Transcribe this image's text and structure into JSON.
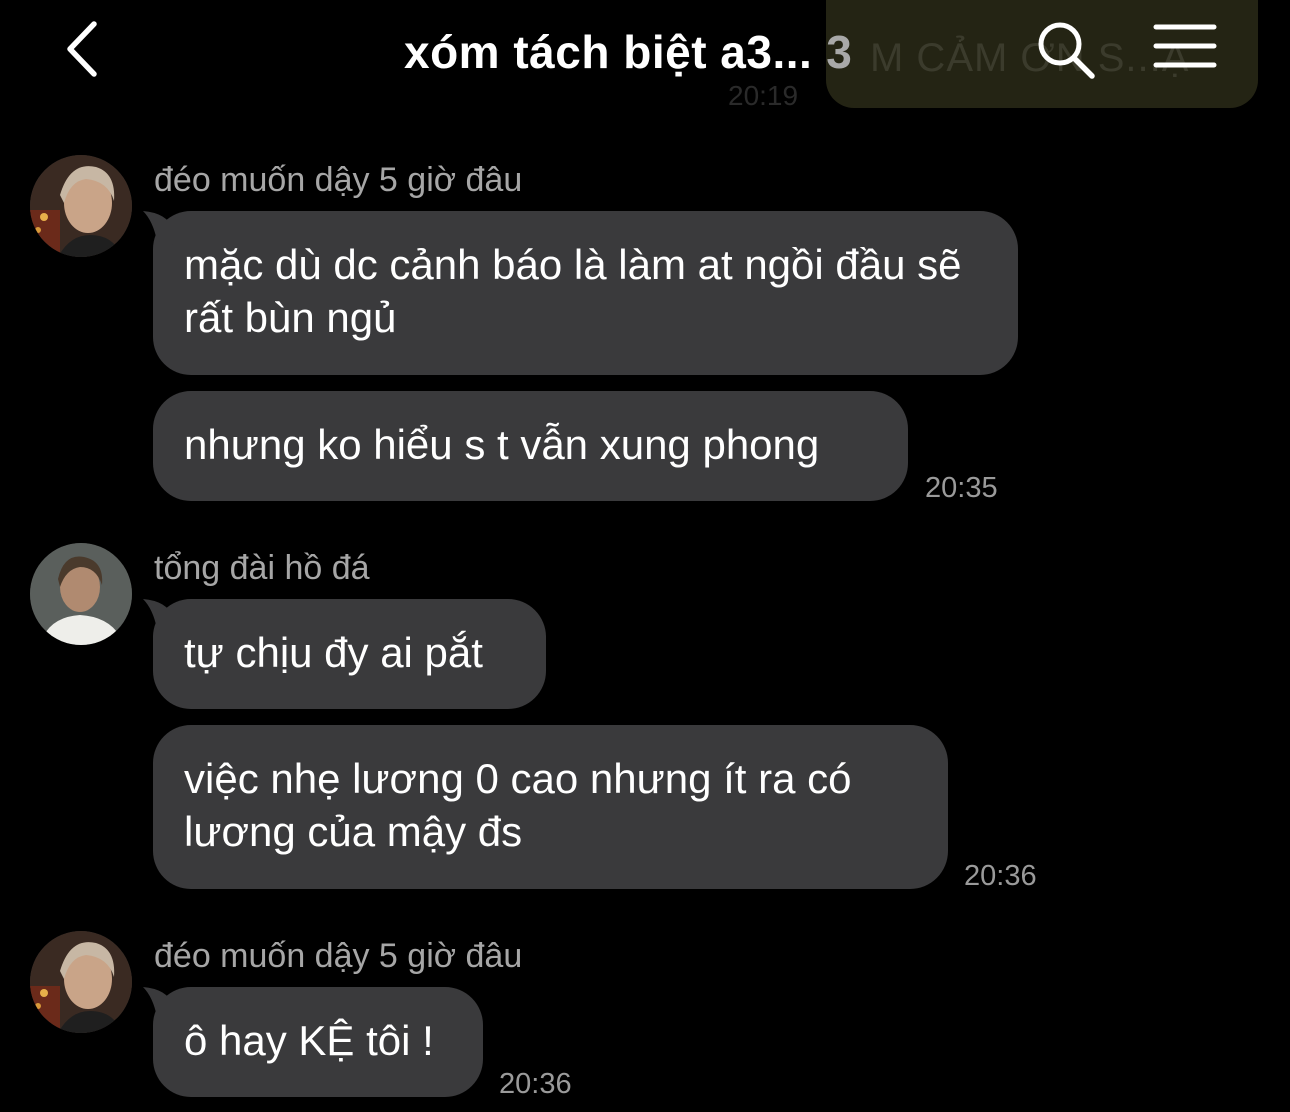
{
  "header": {
    "title": "xóm tách biệt a3...",
    "member_count": "3",
    "background_message_fragment": "M CẢM ƠN S...Ạ",
    "background_message_time": "20:19"
  },
  "messages": [
    {
      "sender": "đéo muốn dậy 5 giờ đâu",
      "avatar": "avatar-person-1",
      "bubbles": [
        "mặc dù dc cảnh báo là làm at ngồi đầu sẽ rất bùn ngủ",
        "nhưng ko hiểu s t vẫn xung phong"
      ],
      "time": "20:35"
    },
    {
      "sender": "tổng đài hồ đá",
      "avatar": "avatar-person-2",
      "bubbles": [
        "tự chịu đy ai pắt",
        "việc nhẹ lương 0 cao nhưng ít ra có lương của mậy đs"
      ],
      "time": "20:36"
    },
    {
      "sender": "đéo muốn dậy 5 giờ đâu",
      "avatar": "avatar-person-1",
      "bubbles": [
        "ô hay KỆ tôi !"
      ],
      "time": "20:36"
    }
  ],
  "colors": {
    "background": "#000000",
    "bubble": "#3a3a3c",
    "sender_name": "#a6a6a6",
    "timestamp": "#9a9a9a"
  }
}
